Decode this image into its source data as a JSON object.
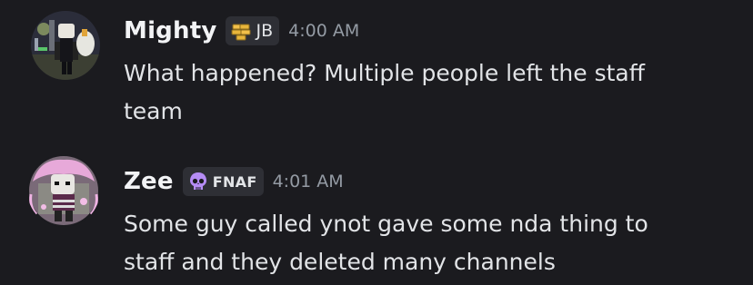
{
  "messages": [
    {
      "username": "Mighty",
      "tag": {
        "icon": "gold-bars-icon",
        "label": "JB"
      },
      "timestamp": "4:00 AM",
      "lines": [
        "What happened? Multiple people left the staff",
        "team"
      ]
    },
    {
      "username": "Zee",
      "tag": {
        "icon": "skull-icon",
        "label": "FNAF"
      },
      "timestamp": "4:01 AM",
      "lines": [
        "Some guy called ynot gave some nda thing to",
        "staff and they deleted many channels"
      ]
    }
  ],
  "colors": {
    "background": "#1b1b1f",
    "username": "#f2f3f5",
    "timestamp": "#949ba4",
    "tag_background": "#2e2f35",
    "message_text": "#e2e4e7",
    "skull_purple": "#b58cf5",
    "gold": "#e8b53a"
  }
}
